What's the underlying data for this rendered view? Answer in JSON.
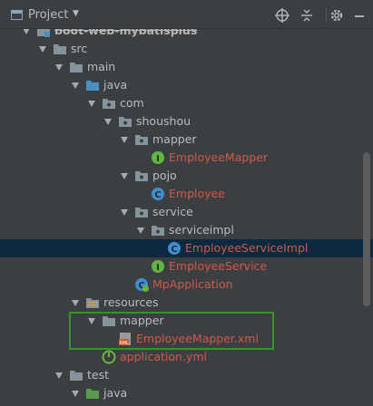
{
  "header": {
    "title": "Project",
    "icons": [
      "project-icon",
      "chevron-down-icon",
      "target-icon",
      "collapse-all-icon",
      "gear-icon",
      "hide-icon"
    ]
  },
  "colors": {
    "background": "#3c3f41",
    "selection": "#0d293e",
    "text": "#bbbbbb",
    "modified_text": "#d0594b",
    "highlight_border": "#3a8f2e"
  },
  "tree": {
    "items": [
      {
        "label": "boot-web-mybatisplus",
        "icon": "module-folder-icon",
        "expanded": true
      },
      {
        "label": "src",
        "icon": "folder-icon",
        "expanded": true
      },
      {
        "label": "main",
        "icon": "folder-icon",
        "expanded": true
      },
      {
        "label": "java",
        "icon": "source-folder-icon",
        "expanded": true
      },
      {
        "label": "com",
        "icon": "package-icon",
        "expanded": true
      },
      {
        "label": "shoushou",
        "icon": "package-icon",
        "expanded": true
      },
      {
        "label": "mapper",
        "icon": "package-icon",
        "expanded": true
      },
      {
        "label": "EmployeeMapper",
        "icon": "interface-icon",
        "expanded": null
      },
      {
        "label": "pojo",
        "icon": "package-icon",
        "expanded": true
      },
      {
        "label": "Employee",
        "icon": "class-icon",
        "expanded": null
      },
      {
        "label": "service",
        "icon": "package-icon",
        "expanded": true
      },
      {
        "label": "serviceimpl",
        "icon": "package-icon",
        "expanded": true
      },
      {
        "label": "EmployeeServiceImpl",
        "icon": "class-icon",
        "expanded": null,
        "selected": true
      },
      {
        "label": "EmployeeService",
        "icon": "interface-icon",
        "expanded": null
      },
      {
        "label": "MpApplication",
        "icon": "spring-boot-class-icon",
        "expanded": null
      },
      {
        "label": "resources",
        "icon": "resources-folder-icon",
        "expanded": true
      },
      {
        "label": "mapper",
        "icon": "folder-icon",
        "expanded": true
      },
      {
        "label": "EmployeeMapper.xml",
        "icon": "xml-file-icon",
        "expanded": null
      },
      {
        "label": "application.yml",
        "icon": "yml-file-icon",
        "expanded": null
      },
      {
        "label": "test",
        "icon": "folder-icon",
        "expanded": true
      },
      {
        "label": "java",
        "icon": "test-source-folder-icon",
        "expanded": true
      }
    ]
  }
}
